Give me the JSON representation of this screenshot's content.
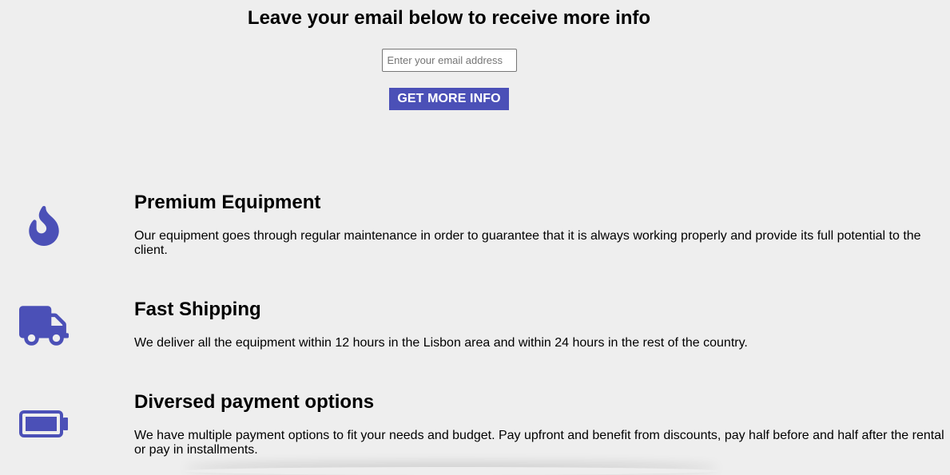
{
  "signup": {
    "heading": "Leave your email below to receive more info",
    "email_placeholder": "Enter your email address",
    "email_value": "",
    "button_label": "GET MORE INFO"
  },
  "features": [
    {
      "icon": "fire-icon",
      "title": "Premium Equipment",
      "description": "Our equipment goes through regular maintenance in order to guarantee that it is always working properly and provide its full potential to the client."
    },
    {
      "icon": "truck-icon",
      "title": "Fast Shipping",
      "description": "We deliver all the equipment within 12 hours in the Lisbon area and within 24 hours in the rest of the country."
    },
    {
      "icon": "battery-icon",
      "title": "Diversed payment options",
      "description": "We have multiple payment options to fit your needs and budget. Pay upfront and benefit from discounts, pay half before and half after the rental or pay in installments."
    }
  ],
  "colors": {
    "accent": "#4b50b7",
    "background": "#eeeeee",
    "text": "#000000"
  }
}
